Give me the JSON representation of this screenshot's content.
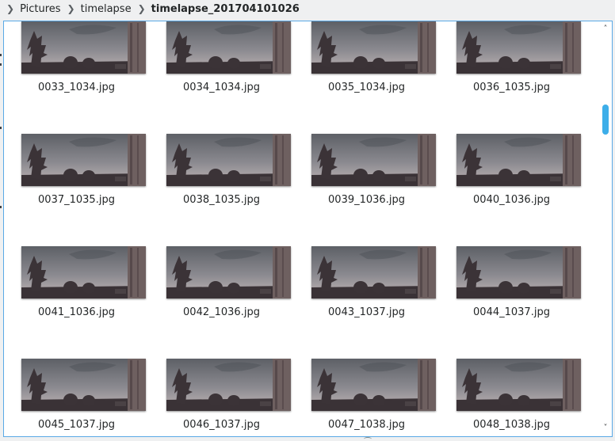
{
  "breadcrumb": [
    {
      "label": "Pictures"
    },
    {
      "label": "timelapse"
    },
    {
      "label": "timelapse_201704101026",
      "current": true
    }
  ],
  "icons": {
    "separator": "chevron-right-icon",
    "scroll_up": "chevron-up-icon",
    "scroll_down": "chevron-down-icon"
  },
  "scroll_position": 0.19,
  "thumbnail_colors": {
    "sky_top": "#5d6066",
    "sky_bottom": "#c3b8b8",
    "tree": "#3b3337",
    "building": "#6e6060",
    "selection_border": "#5aa9e6",
    "scroll_handle": "#3daee9"
  },
  "files": [
    {
      "name": "0033_1034.jpg"
    },
    {
      "name": "0034_1034.jpg"
    },
    {
      "name": "0035_1034.jpg"
    },
    {
      "name": "0036_1035.jpg"
    },
    {
      "name": "0037_1035.jpg"
    },
    {
      "name": "0038_1035.jpg"
    },
    {
      "name": "0039_1036.jpg"
    },
    {
      "name": "0040_1036.jpg"
    },
    {
      "name": "0041_1036.jpg"
    },
    {
      "name": "0042_1036.jpg"
    },
    {
      "name": "0043_1037.jpg"
    },
    {
      "name": "0044_1037.jpg"
    },
    {
      "name": "0045_1037.jpg"
    },
    {
      "name": "0046_1037.jpg"
    },
    {
      "name": "0047_1038.jpg"
    },
    {
      "name": "0048_1038.jpg"
    }
  ]
}
